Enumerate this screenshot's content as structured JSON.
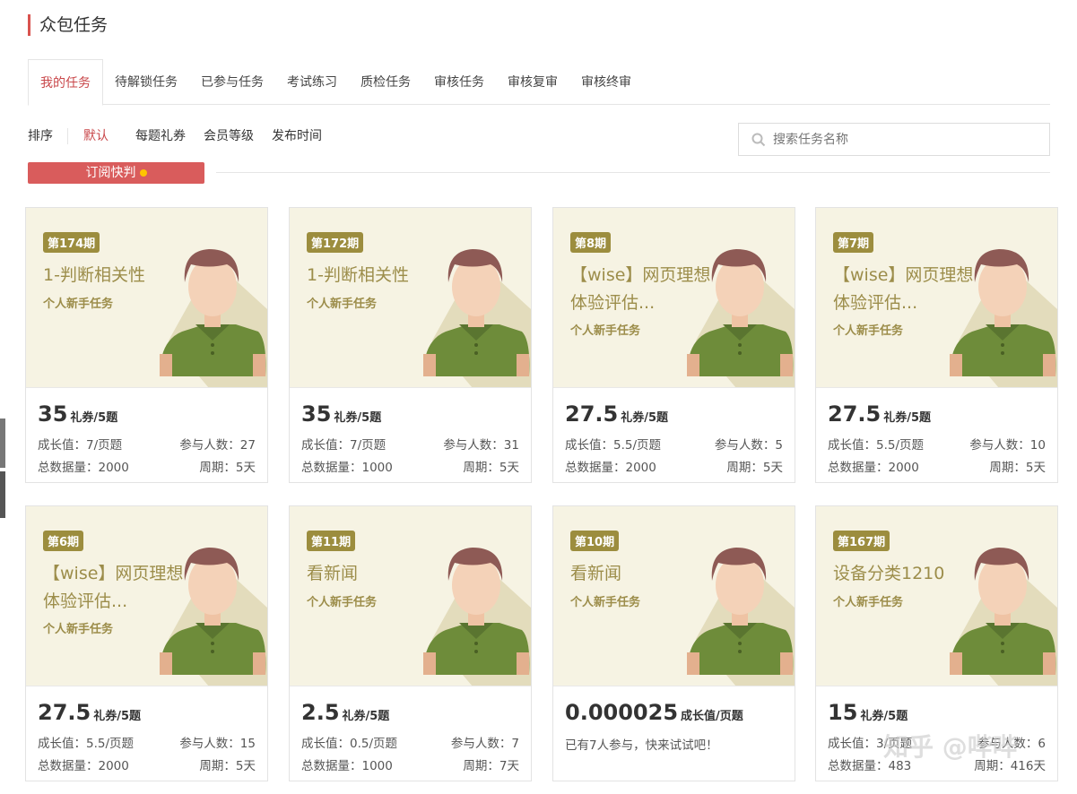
{
  "header": {
    "title": "众包任务"
  },
  "tabs": [
    "我的任务",
    "待解锁任务",
    "已参与任务",
    "考试练习",
    "质检任务",
    "审核任务",
    "审核复审",
    "审核终审"
  ],
  "sort": {
    "label": "排序",
    "options": [
      "默认",
      "每题礼券",
      "会员等级",
      "发布时间"
    ]
  },
  "search": {
    "placeholder": "搜索任务名称"
  },
  "subscribe": {
    "label": "订阅快判"
  },
  "cards": [
    {
      "issue": "第174期",
      "name": "1-判断相关性",
      "type": "个人新手任务",
      "price": "35",
      "unit": "礼券/5题",
      "growth": "成长值：7/页题",
      "participants": "参与人数：27",
      "total": "总数据量：2000",
      "period": "周期：5天"
    },
    {
      "issue": "第172期",
      "name": "1-判断相关性",
      "type": "个人新手任务",
      "price": "35",
      "unit": "礼券/5题",
      "growth": "成长值：7/页题",
      "participants": "参与人数：31",
      "total": "总数据量：1000",
      "period": "周期：5天"
    },
    {
      "issue": "第8期",
      "name": "【wise】网页理想体验评估...",
      "type": "个人新手任务",
      "price": "27.5",
      "unit": "礼券/5题",
      "growth": "成长值：5.5/页题",
      "participants": "参与人数：5",
      "total": "总数据量：2000",
      "period": "周期：5天"
    },
    {
      "issue": "第7期",
      "name": "【wise】网页理想体验评估...",
      "type": "个人新手任务",
      "price": "27.5",
      "unit": "礼券/5题",
      "growth": "成长值：5.5/页题",
      "participants": "参与人数：10",
      "total": "总数据量：2000",
      "period": "周期：5天"
    },
    {
      "issue": "第6期",
      "name": "【wise】网页理想体验评估...",
      "type": "个人新手任务",
      "price": "27.5",
      "unit": "礼券/5题",
      "growth": "成长值：5.5/页题",
      "participants": "参与人数：15",
      "total": "总数据量：2000",
      "period": "周期：5天"
    },
    {
      "issue": "第11期",
      "name": "看新闻",
      "type": "个人新手任务",
      "price": "2.5",
      "unit": "礼券/5题",
      "growth": "成长值：0.5/页题",
      "participants": "参与人数：7",
      "total": "总数据量：1000",
      "period": "周期：7天"
    },
    {
      "issue": "第10期",
      "name": "看新闻",
      "type": "个人新手任务",
      "price": "0.000025",
      "unit": "成长值/页题",
      "note": "已有7人参与，快来试试吧！"
    },
    {
      "issue": "第167期",
      "name": "设备分类1210",
      "type": "个人新手任务",
      "price": "15",
      "unit": "礼券/5题",
      "growth": "成长值：3/页题",
      "participants": "参与人数：6",
      "total": "总数据量：483",
      "period": "周期：416天"
    }
  ],
  "watermark": "知乎 @哔哔"
}
